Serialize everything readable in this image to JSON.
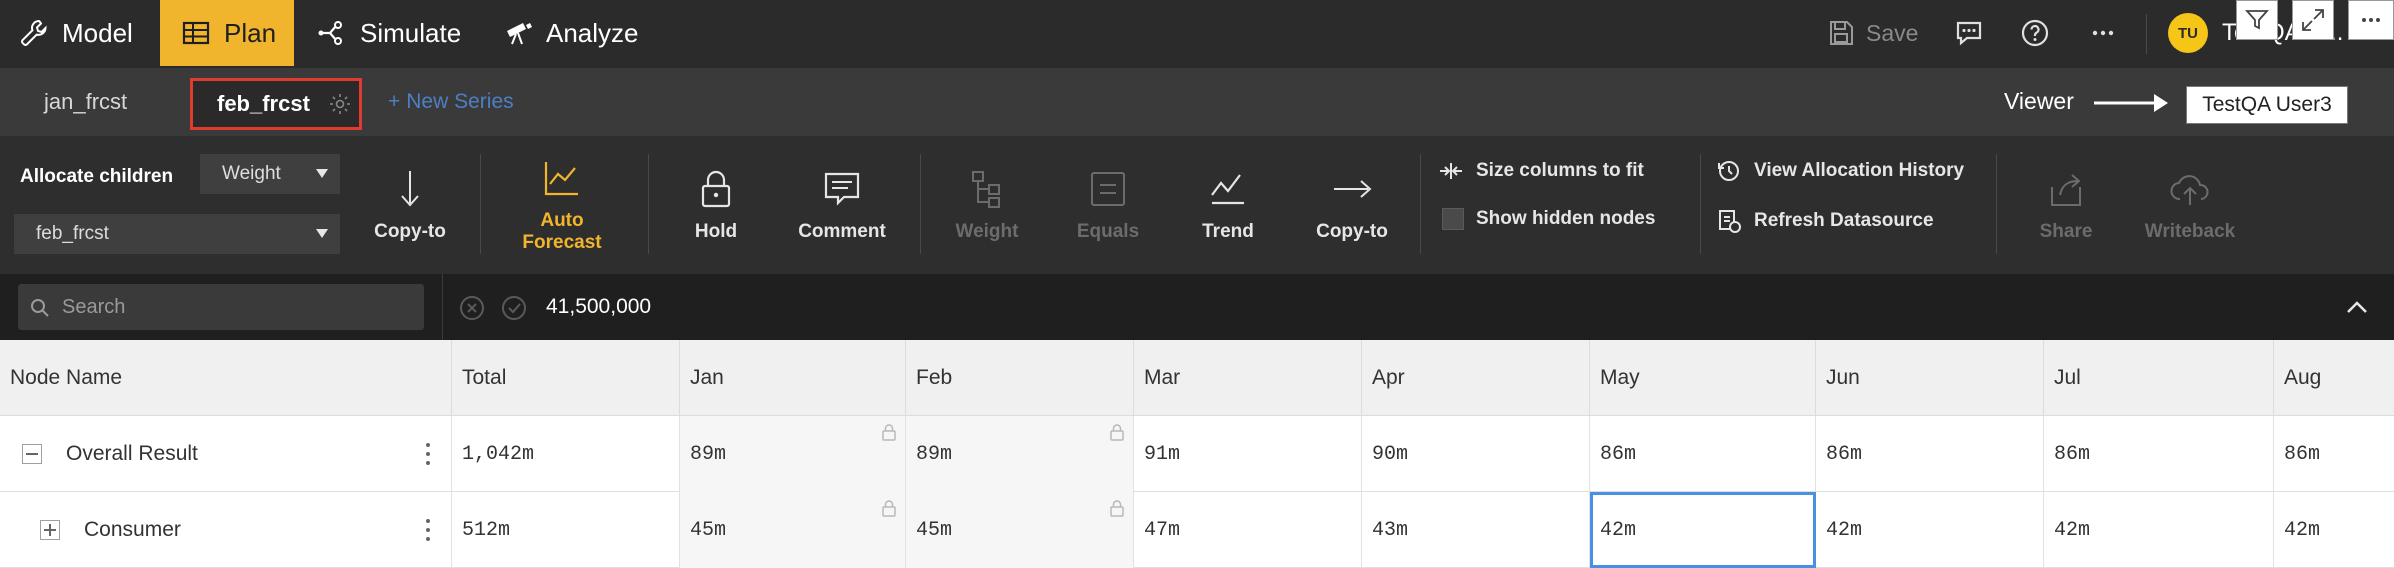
{
  "nav": {
    "items": [
      {
        "label": "Model",
        "icon": "wrench-icon"
      },
      {
        "label": "Plan",
        "icon": "table-icon",
        "active": true
      },
      {
        "label": "Simulate",
        "icon": "branch-icon"
      },
      {
        "label": "Analyze",
        "icon": "telescope-icon"
      }
    ],
    "save_label": "Save",
    "user_initials": "TU",
    "user_name": "TestQA U..."
  },
  "series": {
    "tabs": [
      {
        "label": "jan_frcst",
        "active": false
      },
      {
        "label": "feb_frcst",
        "active": true
      }
    ],
    "new_series_label": "New Series",
    "viewer_label": "Viewer",
    "viewer_user": "TestQA User3"
  },
  "toolbar": {
    "allocate_label": "Allocate children",
    "allocate_method": "Weight",
    "series_select": "feb_frcst",
    "copy_to_label": "Copy-to",
    "auto_forecast_label": "Auto Forecast",
    "hold_label": "Hold",
    "comment_label": "Comment",
    "weight_label": "Weight",
    "equals_label": "Equals",
    "trend_label": "Trend",
    "copy_to_label_2": "Copy-to",
    "size_columns_label": "Size columns to fit",
    "show_hidden_label": "Show hidden nodes",
    "view_history_label": "View Allocation History",
    "refresh_label": "Refresh Datasource",
    "share_label": "Share",
    "writeback_label": "Writeback"
  },
  "formula_bar": {
    "search_placeholder": "Search",
    "value": "41,500,000"
  },
  "grid": {
    "headers": [
      "Node Name",
      "Total",
      "Jan",
      "Feb",
      "Mar",
      "Apr",
      "May",
      "Jun",
      "Jul",
      "Aug"
    ],
    "rows": [
      {
        "name": "Overall Result",
        "values": [
          "1,042m",
          "89m",
          "89m",
          "91m",
          "90m",
          "86m",
          "86m",
          "86m",
          "86m"
        ],
        "expanded": true
      },
      {
        "name": "Consumer",
        "values": [
          "512m",
          "45m",
          "45m",
          "47m",
          "43m",
          "42m",
          "42m",
          "42m",
          "42m"
        ],
        "expanded": false
      }
    ]
  },
  "colors": {
    "accent": "#f1b52d",
    "active_tab_border": "#e03b2f",
    "selection": "#4a90e2",
    "new_series": "#4d7fc4"
  }
}
